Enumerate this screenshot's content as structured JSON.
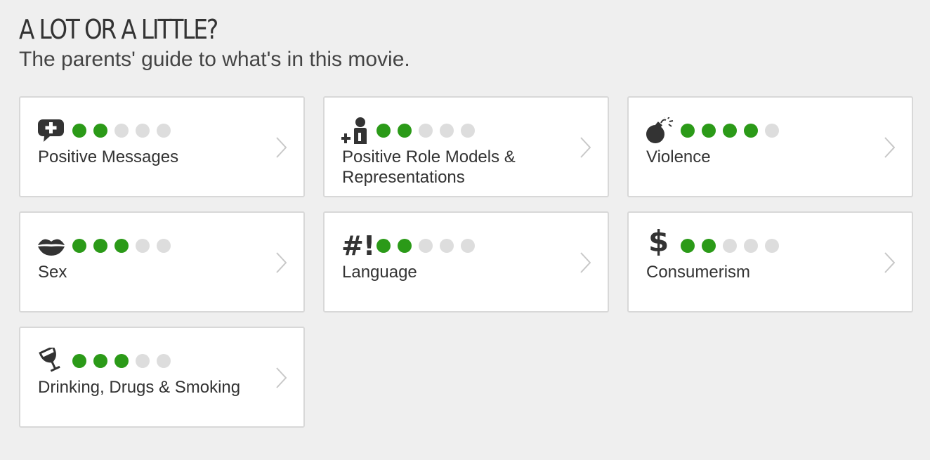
{
  "header": {
    "title": "A LOT OR A LITTLE?",
    "subtitle": "The parents' guide to what's in this movie."
  },
  "rating_max": 5,
  "colors": {
    "dot_on": "#2b9a18",
    "dot_off": "#dddddd",
    "icon": "#333333",
    "card_border": "#d8d8d8",
    "background": "#efefef"
  },
  "categories": [
    {
      "id": "positive-messages",
      "label": "Positive Messages",
      "rating": 2,
      "icon": "speech-bubble-plus-icon"
    },
    {
      "id": "positive-role-models",
      "label": "Positive Role Models & Representations",
      "rating": 2,
      "icon": "person-plus-icon"
    },
    {
      "id": "violence",
      "label": "Violence",
      "rating": 4,
      "icon": "bomb-icon"
    },
    {
      "id": "sex",
      "label": "Sex",
      "rating": 3,
      "icon": "lips-icon"
    },
    {
      "id": "language",
      "label": "Language",
      "rating": 2,
      "icon": "hash-exclamation-icon",
      "icon_text": "#!"
    },
    {
      "id": "consumerism",
      "label": "Consumerism",
      "rating": 2,
      "icon": "dollar-icon",
      "icon_text": "$"
    },
    {
      "id": "drinking-drugs-smoking",
      "label": "Drinking, Drugs & Smoking",
      "rating": 3,
      "icon": "wine-glass-icon"
    }
  ]
}
